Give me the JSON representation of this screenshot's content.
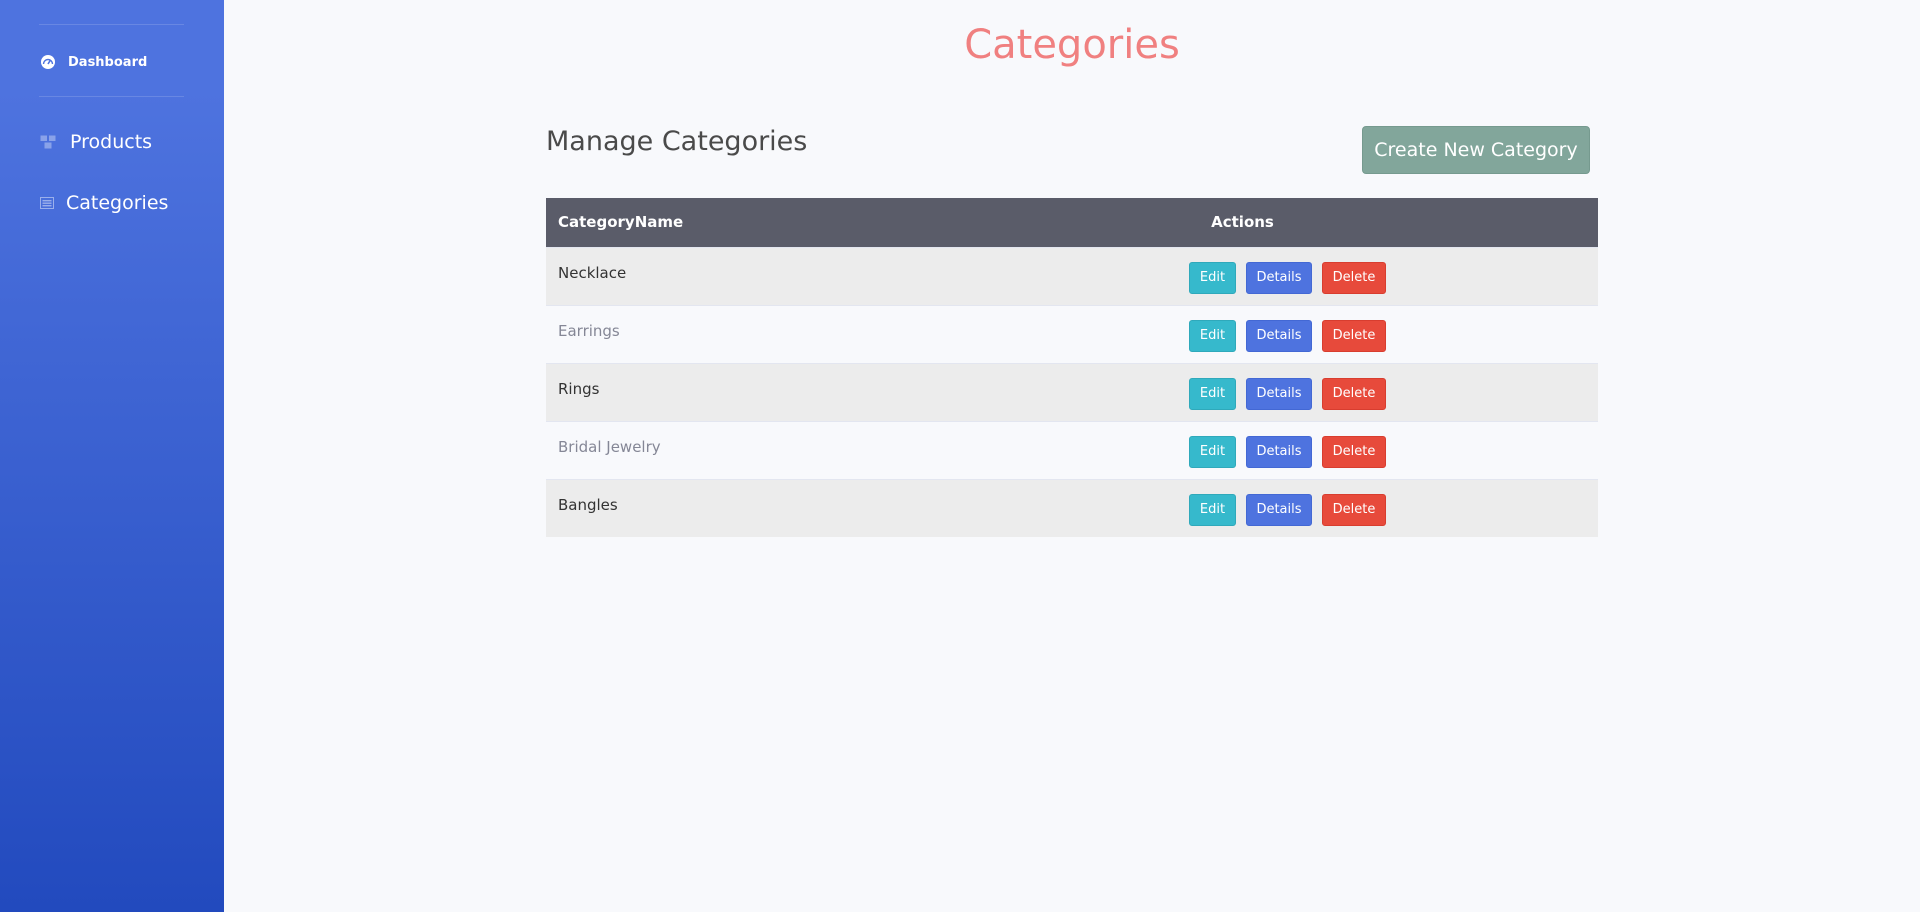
{
  "sidebar": {
    "items": [
      {
        "label": "Dashboard",
        "icon": "tachometer-icon"
      },
      {
        "label": "Products",
        "icon": "boxes-icon"
      },
      {
        "label": "Categories",
        "icon": "list-icon"
      }
    ]
  },
  "header": {
    "title": "Categories"
  },
  "main": {
    "section_title": "Manage Categories",
    "create_button": "Create New Category",
    "table": {
      "columns": [
        "CategoryName",
        "Actions"
      ],
      "rows": [
        {
          "name": "Necklace"
        },
        {
          "name": "Earrings"
        },
        {
          "name": "Rings"
        },
        {
          "name": "Bridal Jewelry"
        },
        {
          "name": "Bangles"
        }
      ],
      "actions": {
        "edit": "Edit",
        "details": "Details",
        "delete": "Delete"
      }
    }
  },
  "colors": {
    "sidebar_top": "#4e73df",
    "sidebar_bottom": "#224abe",
    "title": "#f08080",
    "create_button": "#82a69b",
    "table_header": "#5a5c69",
    "edit": "#36b9cc",
    "details": "#4e73df",
    "delete": "#e74a3b"
  }
}
